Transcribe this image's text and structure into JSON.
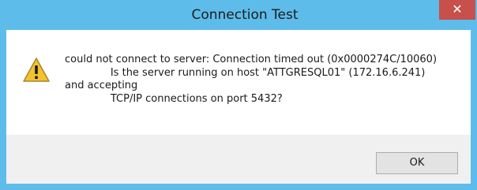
{
  "window": {
    "title": "Connection Test",
    "close_label": "✕"
  },
  "dialog": {
    "icon": "warning-icon",
    "message": "could not connect to server: Connection timed out (0x0000274C/10060)\n              Is the server running on host \"ATTGRESQL01\" (172.16.6.241)\nand accepting\n              TCP/IP connections on port 5432?"
  },
  "footer": {
    "ok_label": "OK"
  },
  "colors": {
    "titlebar": "#5ebcea",
    "close": "#c7504a",
    "warning_fill": "#f2c230"
  }
}
